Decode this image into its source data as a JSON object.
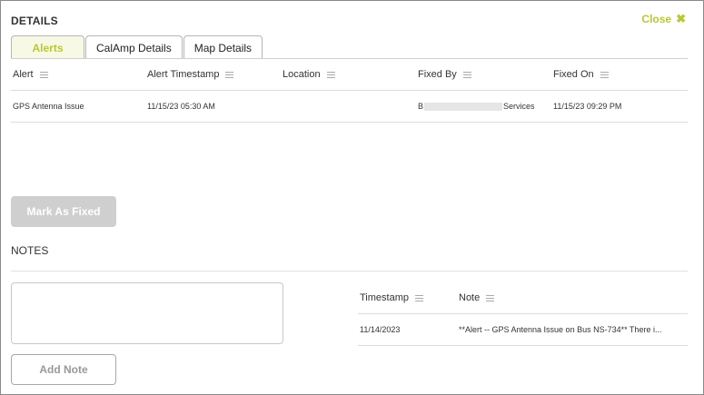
{
  "header": {
    "title": "DETAILS",
    "close_label": "Close",
    "close_icon": "✖"
  },
  "tabs": [
    {
      "label": "Alerts",
      "active": true
    },
    {
      "label": "CalAmp Details",
      "active": false
    },
    {
      "label": "Map Details",
      "active": false
    }
  ],
  "alerts_table": {
    "columns": [
      "Alert",
      "Alert Timestamp",
      "Location",
      "Fixed By",
      "Fixed On"
    ],
    "rows": [
      {
        "alert": "GPS Antenna Issue",
        "timestamp": "11/15/23 05:30 AM",
        "location": "",
        "fixed_by_prefix": "B",
        "fixed_by_suffix": "Services",
        "fixed_on": "11/15/23 09:29 PM"
      }
    ]
  },
  "mark_fixed_label": "Mark As Fixed",
  "notes": {
    "label": "NOTES",
    "input_value": "",
    "add_label": "Add Note",
    "columns": [
      "Timestamp",
      "Note"
    ],
    "rows": [
      {
        "timestamp": "11/14/2023",
        "note": "**Alert -- GPS Antenna Issue on Bus NS-734** There i..."
      }
    ]
  },
  "colors": {
    "accent": "#b8c832",
    "disabled_button": "#cfcfcf",
    "border": "#8a8a8a"
  }
}
